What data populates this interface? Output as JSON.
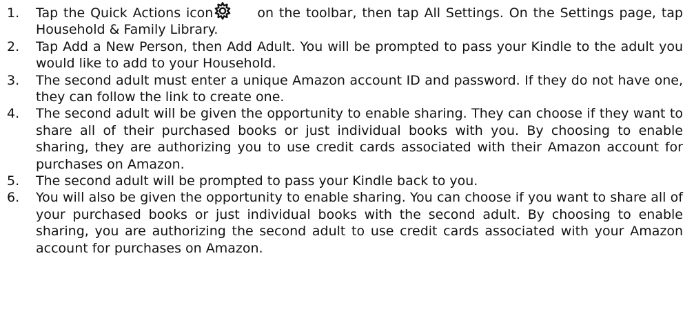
{
  "steps": [
    {
      "number": "1.",
      "before_icon": "Tap the Quick Actions icon",
      "icon": "gear-icon",
      "after_icon": "on the toolbar, then tap All Settings. On the Settings page, tap Household & Family Library."
    },
    {
      "number": "2.",
      "text": "Tap Add a New Person, then Add Adult. You will be prompted to pass your Kindle to the adult you would like to add to your Household."
    },
    {
      "number": "3.",
      "text": "The second adult must enter a unique Amazon account ID and password. If they do not have one, they can follow the link to create one."
    },
    {
      "number": "4.",
      "text": "The second adult will be given the opportunity to enable sharing. They can choose if they want to share all of their purchased books or just individual books with you. By choosing to enable sharing, they are authorizing you to use credit cards associated with their Amazon account for purchases on Amazon."
    },
    {
      "number": "5.",
      "text": "The second adult will be prompted to pass your Kindle back to you."
    },
    {
      "number": "6.",
      "text": "You will also be given the opportunity to enable sharing. You can choose if you want to share all of your purchased books or just individual books with the second adult. By choosing to enable sharing, you are authorizing the second adult to use credit cards associated with your Amazon account for purchases on Amazon."
    }
  ],
  "colors": {
    "text": "#111111",
    "background": "#ffffff"
  }
}
